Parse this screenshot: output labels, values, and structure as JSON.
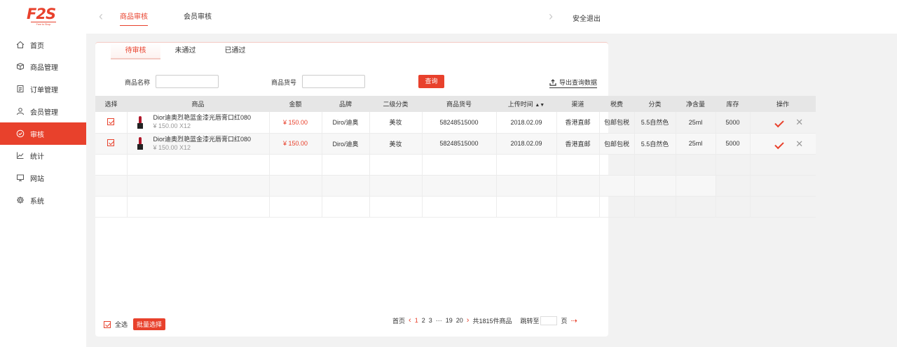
{
  "brand": {
    "logo_text": "F2S",
    "logo_sub": "Free to Shop",
    "color": "#e8412c"
  },
  "header": {
    "tabs": [
      {
        "label": "商品审核",
        "active": true
      },
      {
        "label": "会员审核",
        "active": false
      }
    ],
    "logout": "安全退出"
  },
  "sidebar": {
    "items": [
      {
        "label": "首页",
        "icon": "home-icon"
      },
      {
        "label": "商品管理",
        "icon": "box-icon"
      },
      {
        "label": "订单管理",
        "icon": "order-icon"
      },
      {
        "label": "会员管理",
        "icon": "member-icon"
      },
      {
        "label": "审核",
        "icon": "check-circle-icon",
        "active": true
      },
      {
        "label": "统计",
        "icon": "chart-icon"
      },
      {
        "label": "网站",
        "icon": "monitor-icon"
      },
      {
        "label": "系统",
        "icon": "gear-icon"
      }
    ]
  },
  "subtabs": [
    {
      "label": "待审核",
      "active": true
    },
    {
      "label": "未通过",
      "active": false
    },
    {
      "label": "已通过",
      "active": false
    }
  ],
  "filters": {
    "name_label": "商品名称",
    "name_value": "",
    "sku_label": "商品货号",
    "sku_value": "",
    "query_button": "查询",
    "export_label": "导出查询数据"
  },
  "table": {
    "headers": [
      "选择",
      "商品",
      "金额",
      "品牌",
      "二级分类",
      "商品货号",
      "上传时间",
      "渠道",
      "税费",
      "分类",
      "净含量",
      "库存",
      "操作"
    ],
    "rows": [
      {
        "checked": true,
        "name": "Dior迪奥烈艳蓝金漆光唇膏口红080",
        "sub": "¥ 150.00    X12",
        "amount": "¥ 150.00",
        "brand": "Diro/迪奥",
        "category": "美妆",
        "sku": "58248515000",
        "date": "2018.02.09",
        "channel": "香港直邮",
        "tax": "包邮包税",
        "class": "5.5自然色",
        "net": "25ml",
        "stock": "5000"
      },
      {
        "checked": true,
        "name": "Dior迪奥烈艳蓝金漆光唇膏口红080",
        "sub": "¥ 150.00    X12",
        "amount": "¥ 150.00",
        "brand": "Diro/迪奥",
        "category": "美妆",
        "sku": "58248515000",
        "date": "2018.02.09",
        "channel": "香港直邮",
        "tax": "包邮包税",
        "class": "5.5自然色",
        "net": "25ml",
        "stock": "5000"
      }
    ]
  },
  "footer": {
    "select_all": "全选",
    "batch_button": "批量选择",
    "pager": {
      "first": "首页",
      "pages": [
        "1",
        "2",
        "3",
        "···",
        "19",
        "20"
      ],
      "current": "1",
      "total": "共1815件商品",
      "jump_label": "跳转至",
      "page_unit": "页"
    }
  }
}
